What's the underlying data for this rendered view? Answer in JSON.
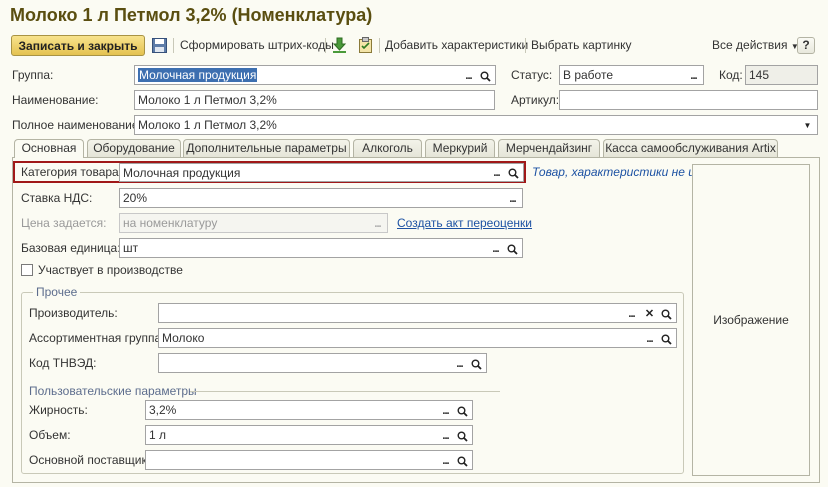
{
  "window": {
    "title": "Молоко 1 л  Петмол 3,2% (Номенклатура)"
  },
  "toolbar": {
    "save_close": "Записать и закрыть",
    "barcodes": "Сформировать штрих-коды",
    "add_characteristics": "Добавить характеристики",
    "choose_picture": "Выбрать картинку",
    "all_actions": "Все действия",
    "help": "?"
  },
  "header": {
    "group_label": "Группа:",
    "group_value": "Молочная продукция",
    "status_label": "Статус:",
    "status_value": "В работе",
    "code_label": "Код:",
    "code_value": "145",
    "name_label": "Наименование:",
    "name_value": "Молоко 1 л  Петмол 3,2%",
    "article_label": "Артикул:",
    "article_value": "",
    "fullname_label": "Полное наименование:",
    "fullname_value": "Молоко 1 л  Петмол 3,2%"
  },
  "tabs": [
    {
      "label": "Основная"
    },
    {
      "label": "Оборудование"
    },
    {
      "label": "Дополнительные параметры"
    },
    {
      "label": "Алкоголь"
    },
    {
      "label": "Меркурий"
    },
    {
      "label": "Мерчендайзинг"
    },
    {
      "label": "Касса самообслуживания Artix"
    }
  ],
  "main": {
    "category_label": "Категория товара:",
    "category_value": "Молочная продукция",
    "category_link": "Товар, характеристики не и...",
    "vat_label": "Ставка НДС:",
    "vat_value": "20%",
    "price_label": "Цена задается:",
    "price_value": "на номенклатуру",
    "revaluation_link": "Создать акт переоценки",
    "unit_label": "Базовая единица:",
    "unit_value": "шт",
    "production_label": "Участвует в производстве",
    "production_checked": false,
    "image_label": "Изображение"
  },
  "other": {
    "title": "Прочее",
    "manufacturer_label": "Производитель:",
    "manufacturer_value": "",
    "assortment_label": "Ассортиментная группа:",
    "assortment_value": "Молоко",
    "tnved_label": "Код ТНВЭД:",
    "tnved_value": ""
  },
  "custom": {
    "title": "Пользовательские параметры",
    "fat_label": "Жирность:",
    "fat_value": "3,2%",
    "volume_label": "Объем:",
    "volume_value": "1 л",
    "supplier_label": "Основной поставщик:",
    "supplier_value": ""
  },
  "colors": {
    "title": "#5a4e10",
    "primary_button": "#e4c250",
    "link": "#1d52a3",
    "highlight_border": "#a01818",
    "selection": "#3d6fb0"
  }
}
